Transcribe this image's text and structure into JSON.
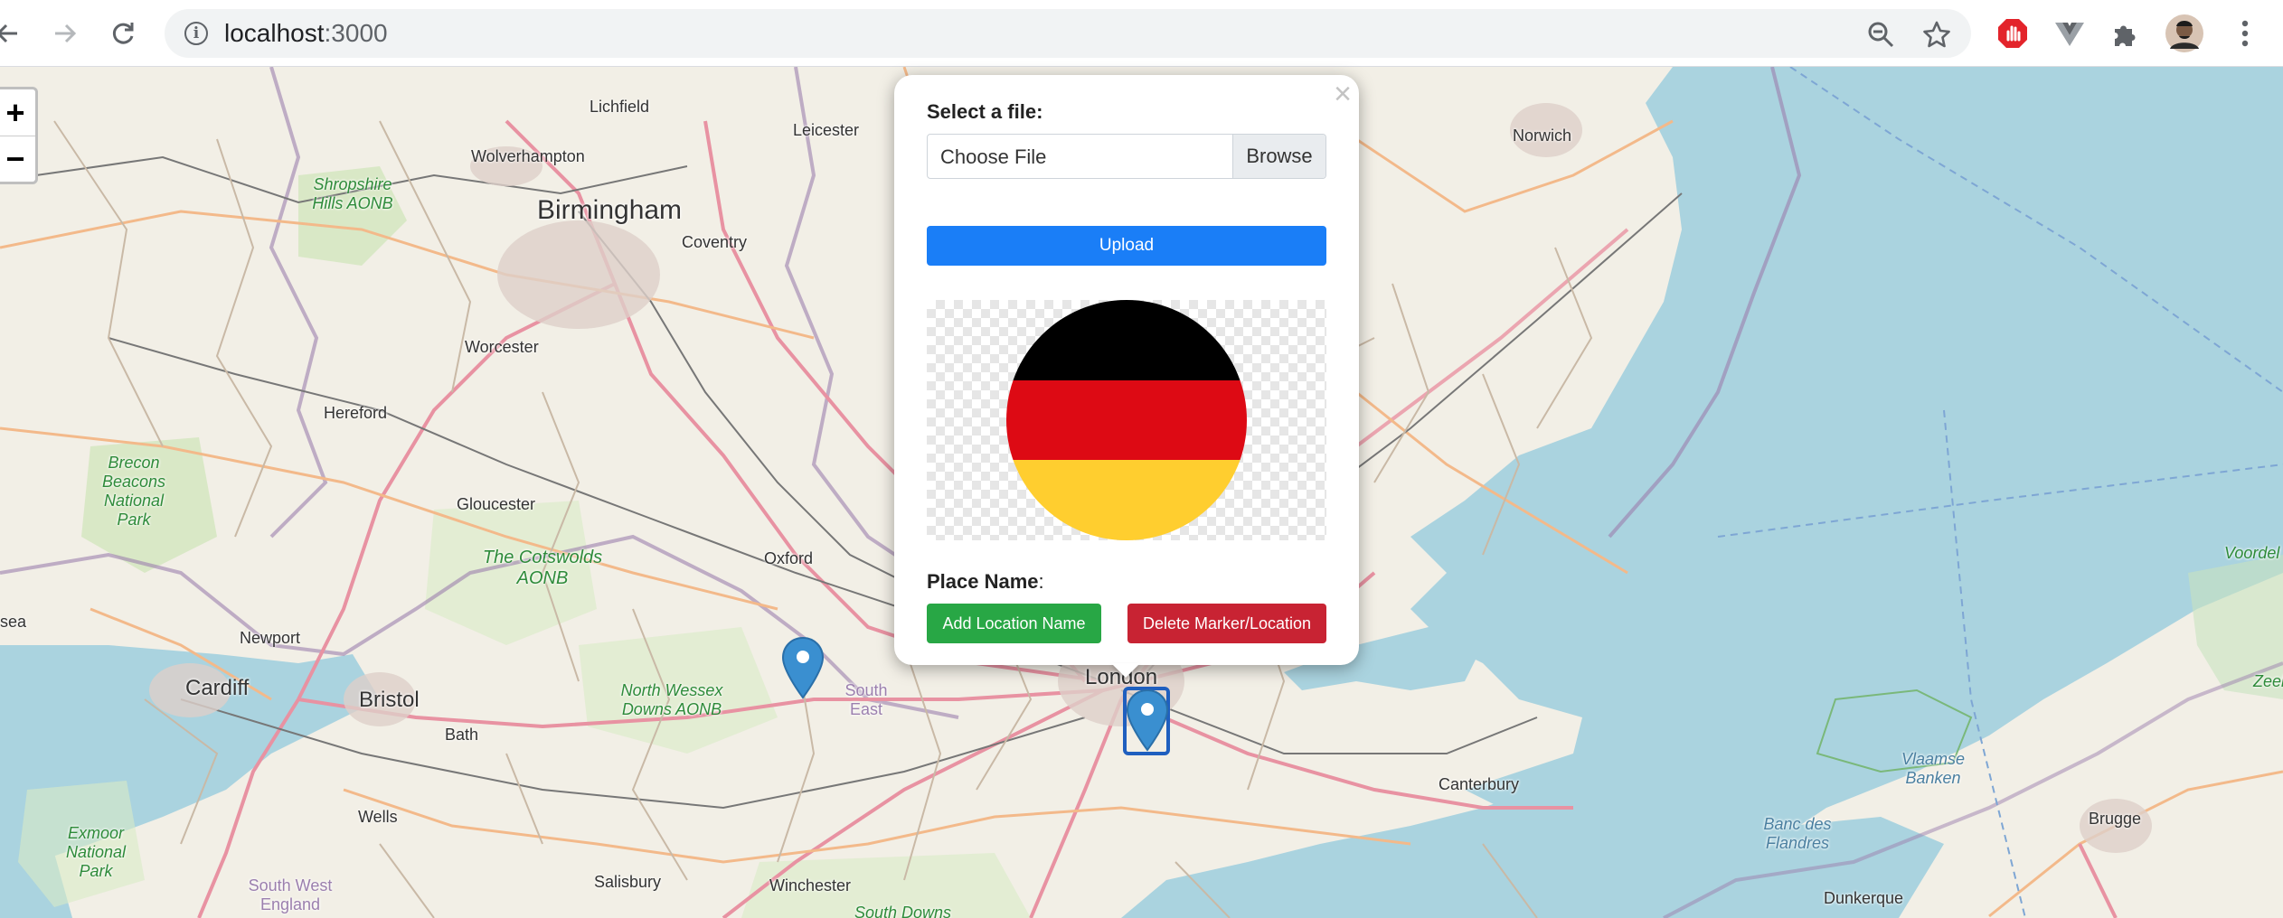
{
  "browser": {
    "url_host": "localhost",
    "url_port": ":3000",
    "icons": [
      "back-icon",
      "forward-icon",
      "reload-icon",
      "info-icon",
      "zoom-out-icon",
      "star-icon",
      "adblock-icon",
      "vue-devtools-icon",
      "extensions-icon",
      "profile-avatar",
      "menu-icon"
    ]
  },
  "map": {
    "zoom_in": "+",
    "zoom_out": "−",
    "places": {
      "lichfield": "Lichfield",
      "leicester": "Leicester",
      "norwich": "Norwich",
      "wolverhampton": "Wolverhampton",
      "shropshire": "Shropshire Hills AONB",
      "birmingham": "Birmingham",
      "coventry": "Coventry",
      "worcester": "Worcester",
      "hereford": "Hereford",
      "brecon": "Brecon Beacons National Park",
      "gloucester": "Gloucester",
      "cotswolds": "The Cotswolds AONB",
      "oxford": "Oxford",
      "newport": "Newport",
      "cardiff": "Cardiff",
      "bristol": "Bristol",
      "north_wessex": "North Wessex Downs AONB",
      "south_east": "South East",
      "bath": "Bath",
      "london": "London",
      "wells": "Wells",
      "canterbury": "Canterbury",
      "exmoor": "Exmoor National Park",
      "south_west": "South West England",
      "salisbury": "Salisbury",
      "winchester": "Winchester",
      "south_downs": "South Downs",
      "vlaamse": "Vlaamse Banken",
      "banc": "Banc des Flandres",
      "brugge": "Brugge",
      "dunkerque": "Dunkerque",
      "sea": "sea",
      "voorde": "Voordel",
      "zeel": "Zeel"
    }
  },
  "popup": {
    "close": "×",
    "select_label": "Select a file:",
    "file_placeholder": "Choose File",
    "browse": "Browse",
    "upload": "Upload",
    "place_label": "Place Name",
    "place_colon": ":",
    "add_button": "Add Location Name",
    "delete_button": "Delete Marker/Location",
    "flag_colors": [
      "#000000",
      "#dd0a14",
      "#ffce2f"
    ]
  },
  "colors": {
    "primary": "#1a7ef7",
    "success": "#28a745",
    "danger": "#c82333",
    "marker": "#3a8fd0",
    "water": "#aad3df",
    "land": "#f2efe6"
  }
}
